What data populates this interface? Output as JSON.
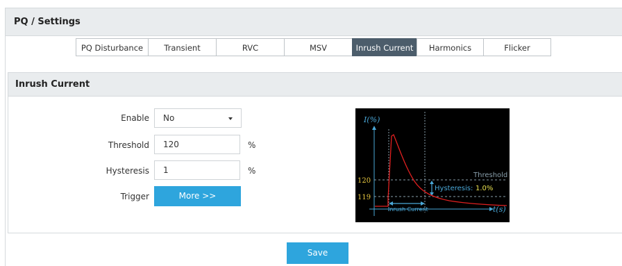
{
  "header": {
    "title": "PQ / Settings"
  },
  "tabs": [
    {
      "label": "PQ Disturbance",
      "active": false
    },
    {
      "label": "Transient",
      "active": false
    },
    {
      "label": "RVC",
      "active": false
    },
    {
      "label": "MSV",
      "active": false
    },
    {
      "label": "Inrush Current",
      "active": true
    },
    {
      "label": "Harmonics",
      "active": false
    },
    {
      "label": "Flicker",
      "active": false
    }
  ],
  "panel": {
    "title": "Inrush Current",
    "enable": {
      "label": "Enable",
      "value": "No"
    },
    "threshold": {
      "label": "Threshold",
      "value": "120",
      "unit": "%"
    },
    "hysteresis": {
      "label": "Hysteresis",
      "value": "1",
      "unit": "%"
    },
    "trigger": {
      "label": "Trigger",
      "button": "More >>"
    }
  },
  "diagram": {
    "y_axis": "I(%)",
    "x_axis": "t(s)",
    "threshold_label": "Threshold",
    "hysteresis_label": "Hysteresis:",
    "hysteresis_value": "1.0%",
    "level_high": "120",
    "level_low": "119",
    "inrush_label": "Inrush Current"
  },
  "save_label": "Save",
  "colors": {
    "accent": "#2ea5dd",
    "active_tab": "#4c5d6b",
    "header_bg": "#e9ecee"
  }
}
